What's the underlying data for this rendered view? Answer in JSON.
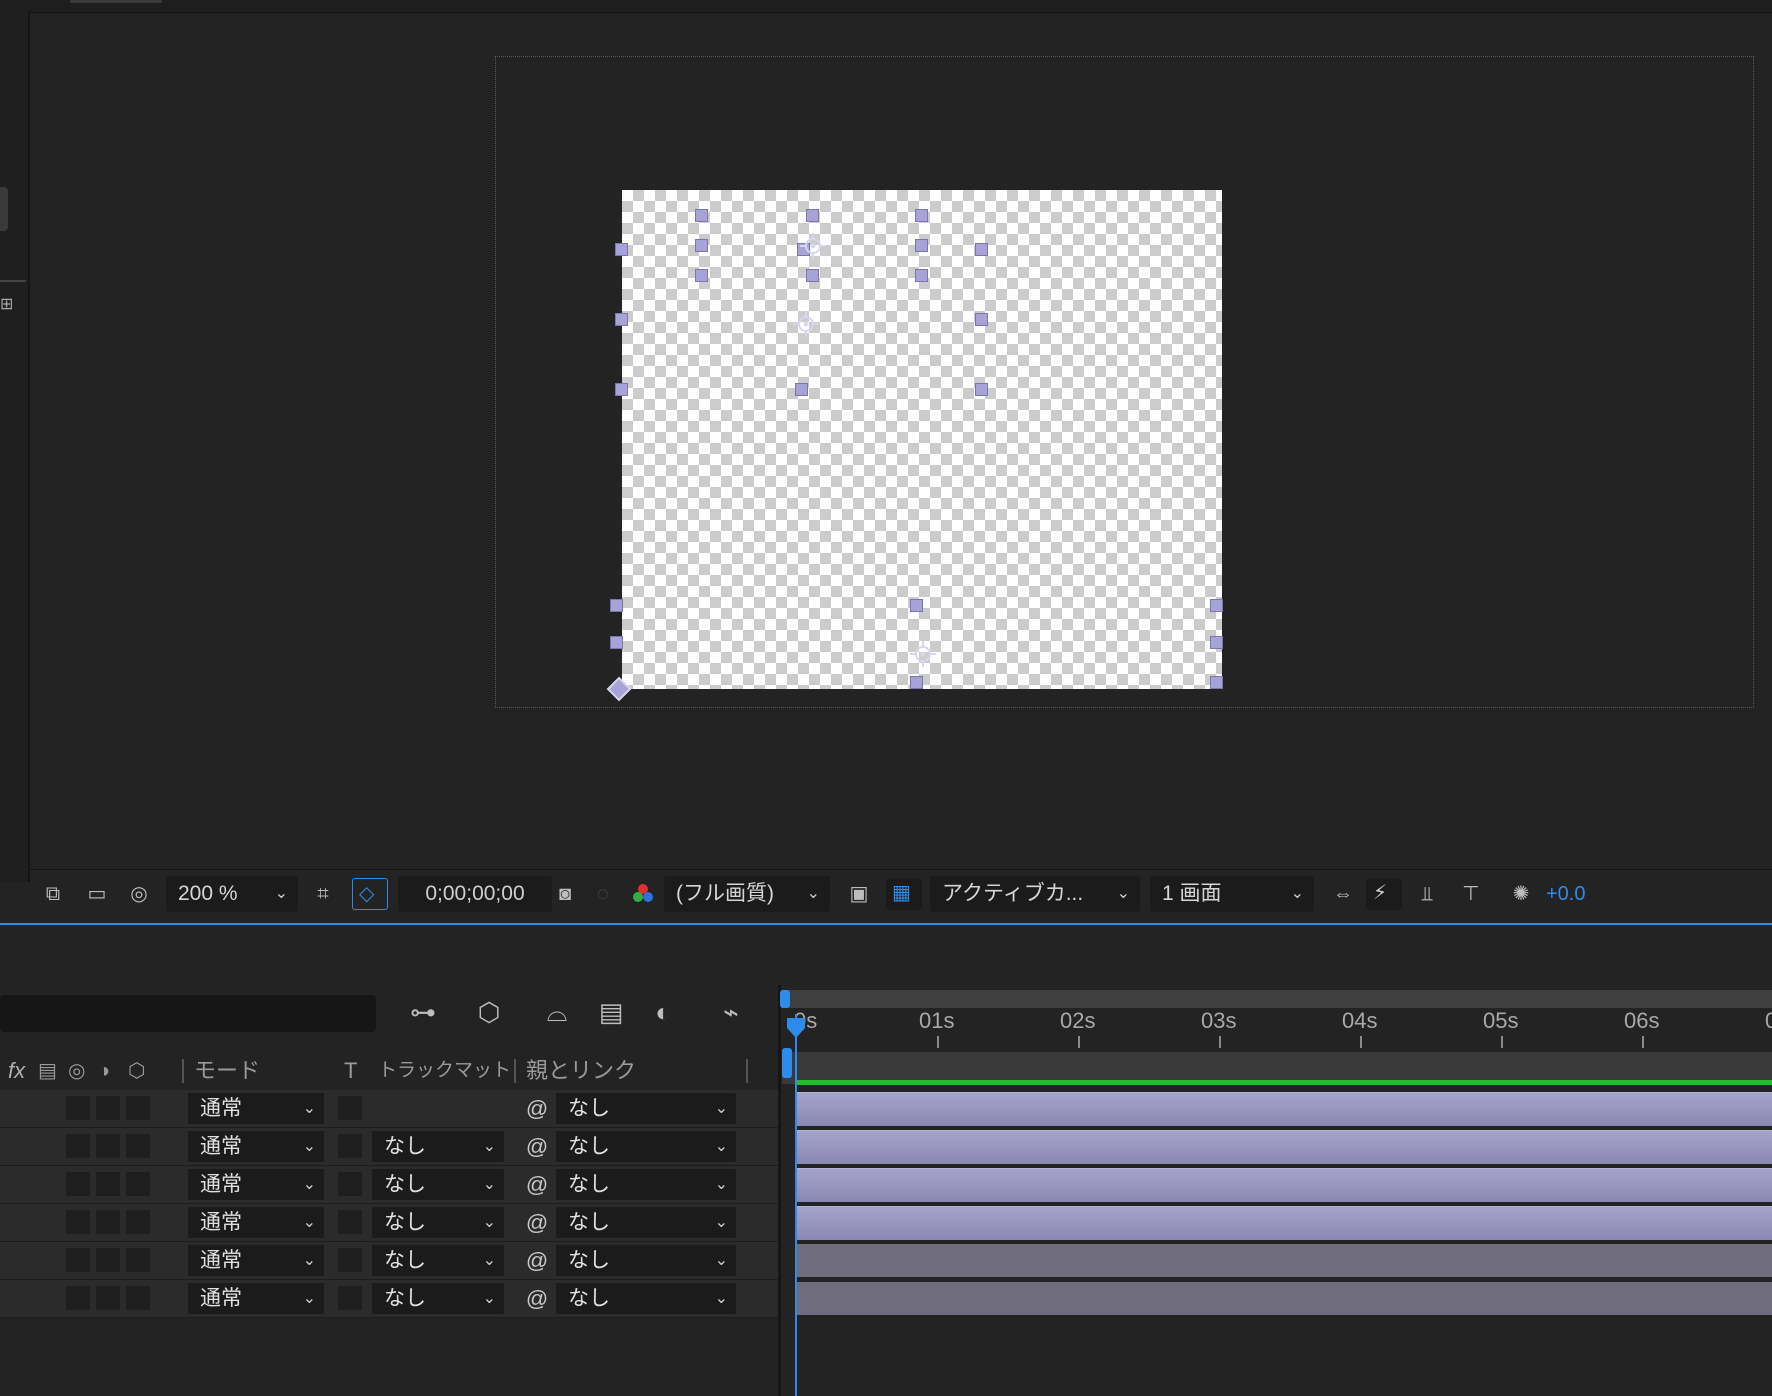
{
  "viewer": {
    "toolbar": {
      "zoom": "200 %",
      "timecode": "0;00;00;00",
      "resolution": "(フル画質)",
      "camera": "アクティブカ...",
      "views": "1 画面",
      "exposure": "+0.0"
    }
  },
  "timeline": {
    "columns": {
      "switches": "fx",
      "mode": "モード",
      "t": "T",
      "track_matte": "トラックマット",
      "parent_link": "親とリンク"
    },
    "ruler": [
      "0s",
      "01s",
      "02s",
      "03s",
      "04s",
      "05s",
      "06s",
      "0"
    ],
    "layers": [
      {
        "mode": "通常",
        "track_matte": "",
        "parent": "なし",
        "bar": "lavender"
      },
      {
        "mode": "通常",
        "track_matte": "なし",
        "parent": "なし",
        "bar": "lavender"
      },
      {
        "mode": "通常",
        "track_matte": "なし",
        "parent": "なし",
        "bar": "lavender"
      },
      {
        "mode": "通常",
        "track_matte": "なし",
        "parent": "なし",
        "bar": "lavender"
      },
      {
        "mode": "通常",
        "track_matte": "なし",
        "parent": "なし",
        "bar": "gray"
      },
      {
        "mode": "通常",
        "track_matte": "なし",
        "parent": "なし",
        "bar": "gray"
      }
    ]
  },
  "colors": {
    "accent": "#2d8ceb",
    "handle": "#a8a3d6",
    "cache_green": "#2db82d",
    "layer_lavender": "#9592bb",
    "layer_gray": "#6f6d7c"
  }
}
